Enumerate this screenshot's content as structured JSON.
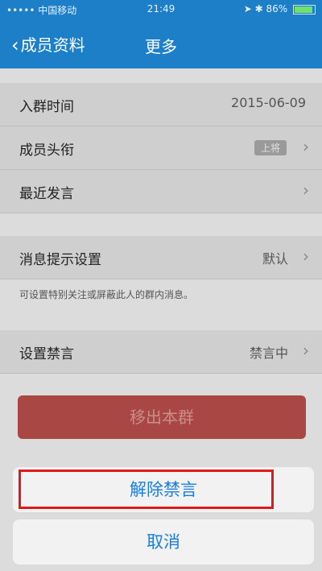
{
  "status_bar": {
    "carrier": "••••• 中国移动",
    "time": "21:49",
    "battery_percent": "86%"
  },
  "nav": {
    "back_label": "成员资料",
    "title": "更多"
  },
  "rows": [
    {
      "label": "入群时间",
      "value": "2015-06-09"
    },
    {
      "label": "成员头衔",
      "tag": "上将"
    },
    {
      "label": "最近发言"
    },
    {
      "label": "消息提示设置",
      "value": "默认"
    },
    {
      "label": "设置禁言",
      "value": "禁言中"
    }
  ],
  "hint": "可设置特别关注或屏蔽此人的群内消息。",
  "remove_button": "移出本群",
  "action_sheet": {
    "unmute": "解除禁言",
    "cancel": "取消"
  },
  "colors": {
    "nav": "#1c7fc7",
    "danger": "#a94745",
    "action": "#1a7ee1",
    "highlight": "#e01a1a"
  }
}
